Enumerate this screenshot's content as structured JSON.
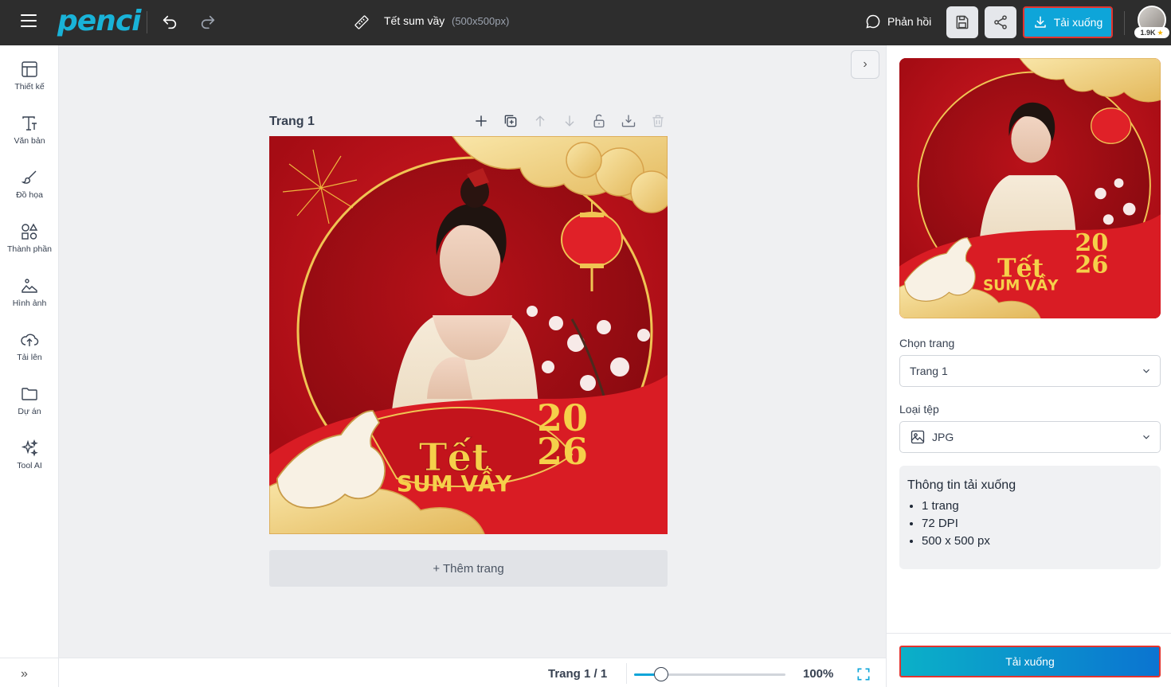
{
  "header": {
    "logo": "penci",
    "doc_title": "Tết sum vầy",
    "doc_size": "(500x500px)",
    "feedback_label": "Phản hồi",
    "download_label": "Tải xuống",
    "avatar_badge": "1.9K"
  },
  "sidebar": {
    "items": [
      {
        "label": "Thiết kế",
        "icon": "layout-icon"
      },
      {
        "label": "Văn bản",
        "icon": "text-icon"
      },
      {
        "label": "Đồ họa",
        "icon": "brush-icon"
      },
      {
        "label": "Thành phần",
        "icon": "shapes-icon"
      },
      {
        "label": "Hình ảnh",
        "icon": "image-icon"
      },
      {
        "label": "Tải lên",
        "icon": "upload-icon"
      },
      {
        "label": "Dự án",
        "icon": "folder-icon"
      },
      {
        "label": "Tool AI",
        "icon": "sparkle-icon"
      }
    ]
  },
  "canvas": {
    "page_label": "Trang 1",
    "add_page": "+ Thêm trang",
    "design_text": {
      "tet": "Tết",
      "sum_vay": "SUM VẦY",
      "year_top": "20",
      "year_bottom": "26"
    }
  },
  "bottombar": {
    "page_count": "Trang 1 / 1",
    "zoom_value": "100%",
    "zoom_fraction": 0.18
  },
  "right_panel": {
    "choose_page_label": "Chọn trang",
    "choose_page_value": "Trang 1",
    "file_type_label": "Loại tệp",
    "file_type_value": "JPG",
    "info_title": "Thông tin tải xuống",
    "info_items": [
      "1 trang",
      "72 DPI",
      "500 x 500 px"
    ],
    "download_label": "Tải xuống"
  },
  "colors": {
    "accent": "#0ea5d9",
    "topbar": "#2d2d2d",
    "highlight_border": "#e3342f",
    "design_red": "#c8101a",
    "design_gold": "#f5d04a"
  }
}
